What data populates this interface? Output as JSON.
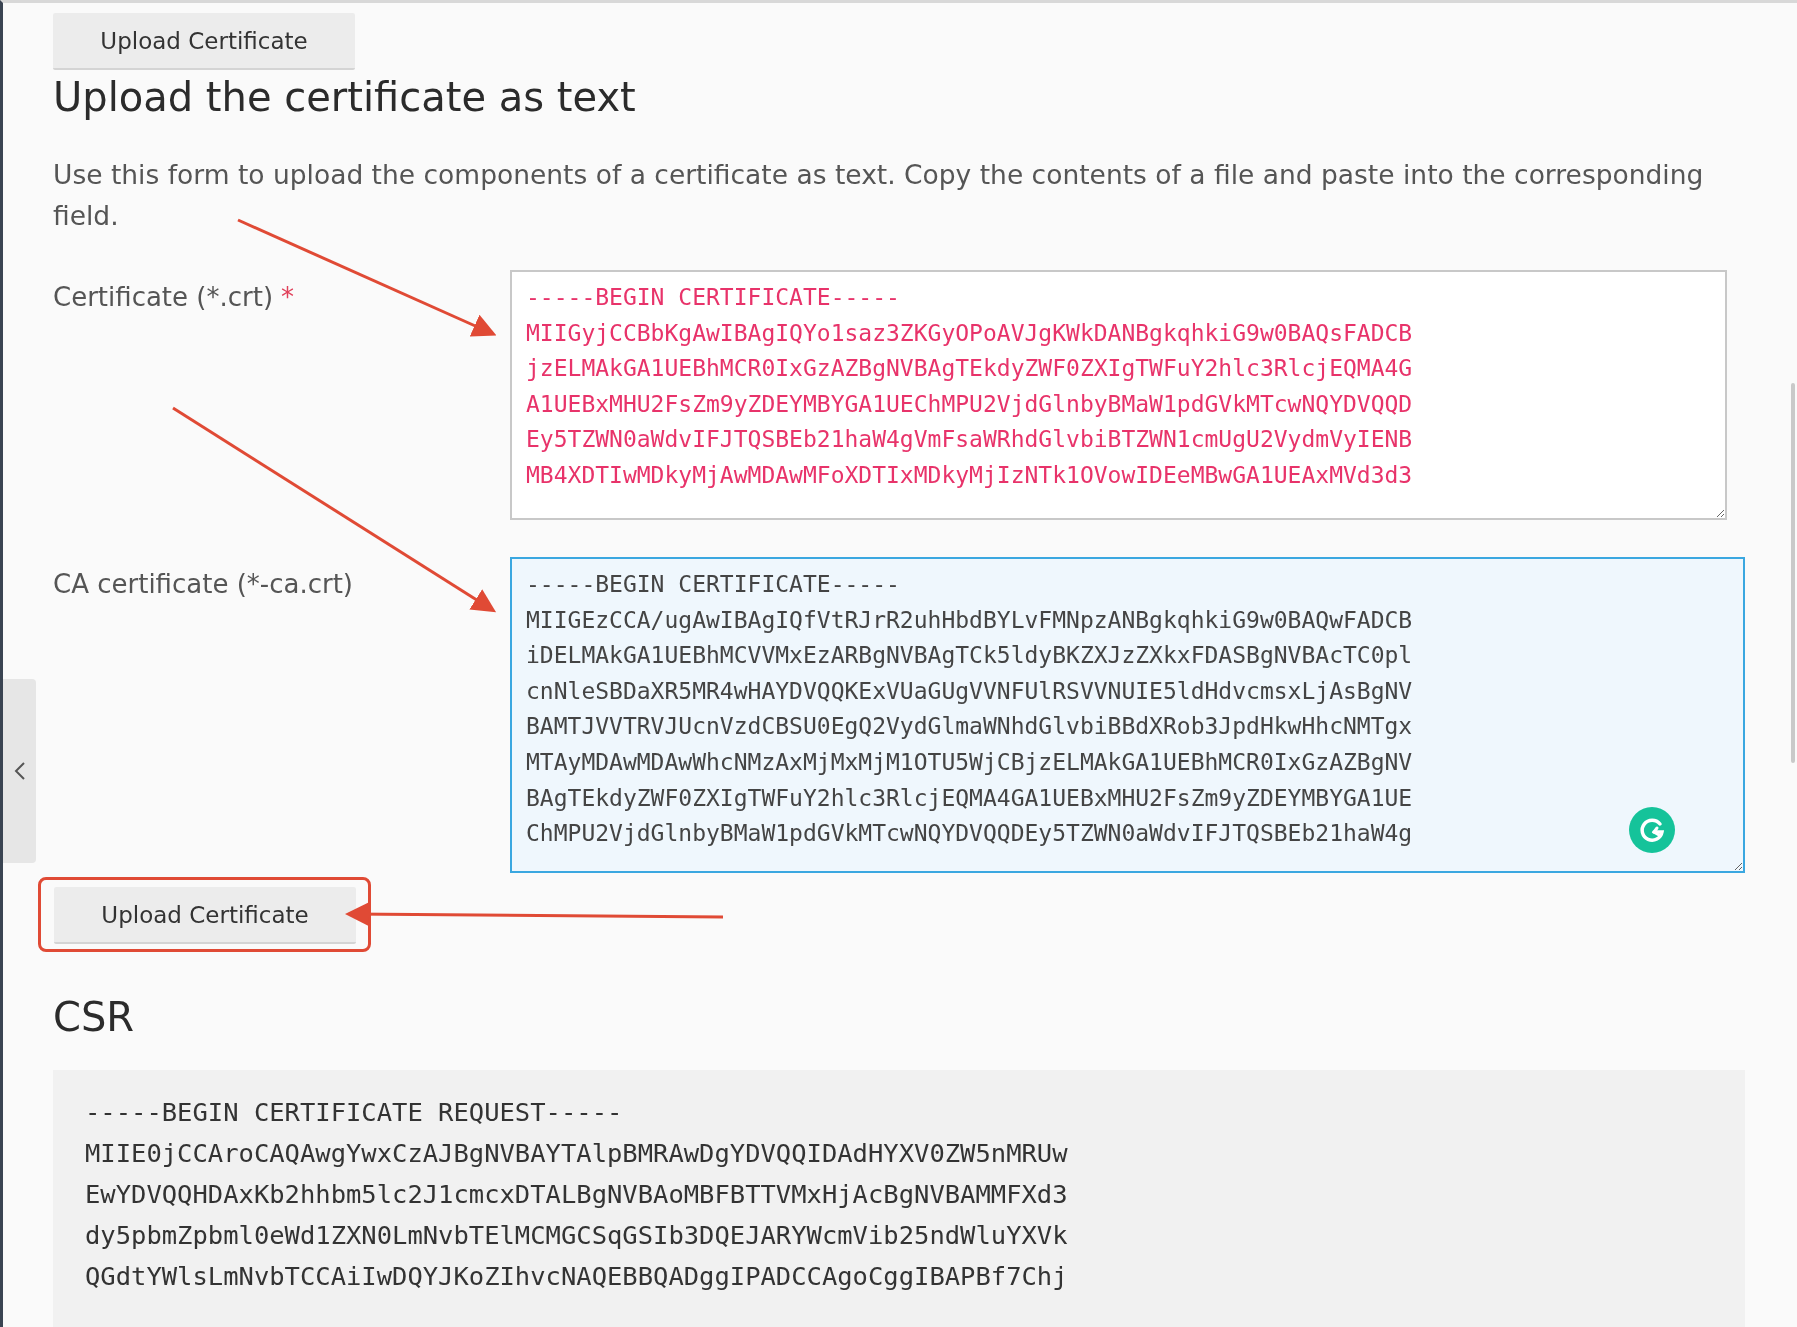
{
  "top_button": "Upload Certificate",
  "heading": "Upload the certificate as text",
  "description": "Use this form to upload the components of a certificate as text. Copy the contents of a file and paste into the corresponding field.",
  "fields": [
    {
      "label": "Certificate (*.crt)",
      "required_mark": "*",
      "invalid": true,
      "focused": false,
      "lines": [
        "-----BEGIN CERTIFICATE-----",
        "MIIGyjCCBbKgAwIBAgIQYo1saz3ZKGyOPoAVJgKWkDANBgkqhkiG9w0BAQsFADCB",
        "jzELMAkGA1UEBhMCR0IxGzAZBgNVBAgTEkdyZWF0ZXIgTWFuY2hlc3RlcjEQMA4G",
        "A1UEBxMHU2FsZm9yZDEYMBYGA1UEChMPU2VjdGlnbyBMaW1pdGVkMTcwNQYDVQQD",
        "Ey5TZWN0aWdvIFJTQSBEb21haW4gVmFsaWRhdGlvbiBTZWN1cmUgU2VydmVyIENB",
        "MB4XDTIwMDkyMjAwMDAwMFoXDTIxMDkyMjIzNTk1OVowIDEeMBwGA1UEAxMVd3d3"
      ]
    },
    {
      "label": "CA certificate (*-ca.crt)",
      "invalid": false,
      "focused": true,
      "lines": [
        "-----BEGIN CERTIFICATE-----",
        "MIIGEzCCA/ugAwIBAgIQfVtRJrR2uhHbdBYLvFMNpzANBgkqhkiG9w0BAQwFADCB",
        "iDELMAkGA1UEBhMCVVMxEzARBgNVBAgTCk5ldyBKZXJzZXkxFDASBgNVBAcTC0pl",
        "cnNleSBDaXR5MR4wHAYDVQQKExVUaGUgVVNFUlRSVVNUIE5ldHdvcmsxLjAsBgNV",
        "BAMTJVVTRVJUcnVzdCBSU0EgQ2VydGlmaWNhdGlvbiBBdXRob3JpdHkwHhcNMTgx",
        "MTAyMDAwMDAwWhcNMzAxMjMxMjM1OTU5WjCBjzELMAkGA1UEBhMCR0IxGzAZBgNV",
        "BAgTEkdyZWF0ZXIgTWFuY2hlc3RlcjEQMA4GA1UEBxMHU2FsZm9yZDEYMBYGA1UE",
        "ChMPU2VjdGlnbyBMaW1pdGVkMTcwNQYDVQQDEy5TZWN0aWdvIFJTQSBEb21haW4g"
      ]
    }
  ],
  "upload_button": "Upload Certificate",
  "csr": {
    "heading": "CSR",
    "lines": [
      "-----BEGIN CERTIFICATE REQUEST-----",
      "MIIE0jCCAroCAQAwgYwxCzAJBgNVBAYTAlpBMRAwDgYDVQQIDAdHYXV0ZW5nMRUw",
      "EwYDVQQHDAxKb2hhbm5lc2J1cmcxDTALBgNVBAoMBFBTTVMxHjAcBgNVBAMMFXd3",
      "dy5pbmZpbml0eWd1ZXN0LmNvbTElMCMGCSqGSIb3DQEJARYWcmVib25ndWluYXVk",
      "QGdtYWlsLmNvbTCCAiIwDQYJKoZIhvcNAQEBBQADggIPADCCAgoCggIBAPBf7Chj"
    ]
  }
}
